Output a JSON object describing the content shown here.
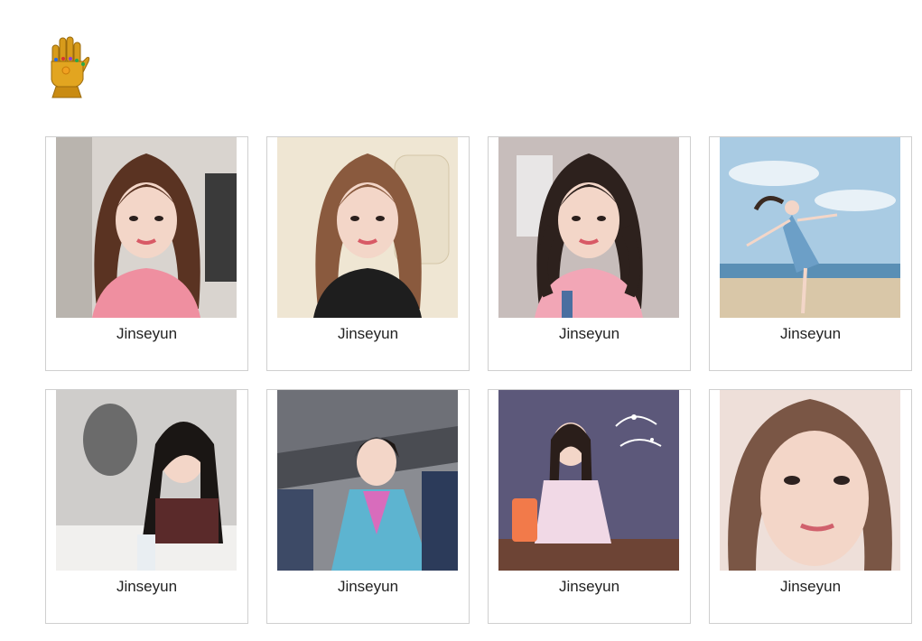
{
  "header": {
    "logo_icon": "gauntlet-icon"
  },
  "gallery": {
    "items": [
      {
        "caption": "Jinseyun",
        "scene": "selfie-indoor",
        "bg": "#d9d4cf",
        "hair": "#5a3322",
        "top": "#ef8fa0"
      },
      {
        "caption": "Jinseyun",
        "scene": "car-selfie",
        "bg": "#e8dcc6",
        "hair": "#8a5a3e",
        "top": "#1e1e1e"
      },
      {
        "caption": "Jinseyun",
        "scene": "pigtails",
        "bg": "#cfc6c4",
        "hair": "#2d211d",
        "top": "#f2a6b6"
      },
      {
        "caption": "Jinseyun",
        "scene": "beach",
        "bg": "#9fc4de",
        "hair": "#3a2a22",
        "top": "#6c9fc7"
      },
      {
        "caption": "Jinseyun",
        "scene": "script-reading",
        "bg": "#c8c6c4",
        "hair": "#1a1614",
        "top": "#5a2a2a"
      },
      {
        "caption": "Jinseyun",
        "scene": "hanbok",
        "bg": "#8a8c92",
        "hair": "#1e1714",
        "top": "#d86cbc"
      },
      {
        "caption": "Jinseyun",
        "scene": "cafe-new-year",
        "bg": "#6f6b85",
        "hair": "#2a1e1a",
        "top": "#f1d9e6"
      },
      {
        "caption": "Jinseyun",
        "scene": "closeup",
        "bg": "#e6d2cc",
        "hair": "#7a5645",
        "top": "#d6b0a8"
      }
    ]
  },
  "colors": {
    "card_border": "#cfcfcf",
    "gauntlet_gold": "#d79b1b",
    "skin": "#f3d6c8"
  }
}
